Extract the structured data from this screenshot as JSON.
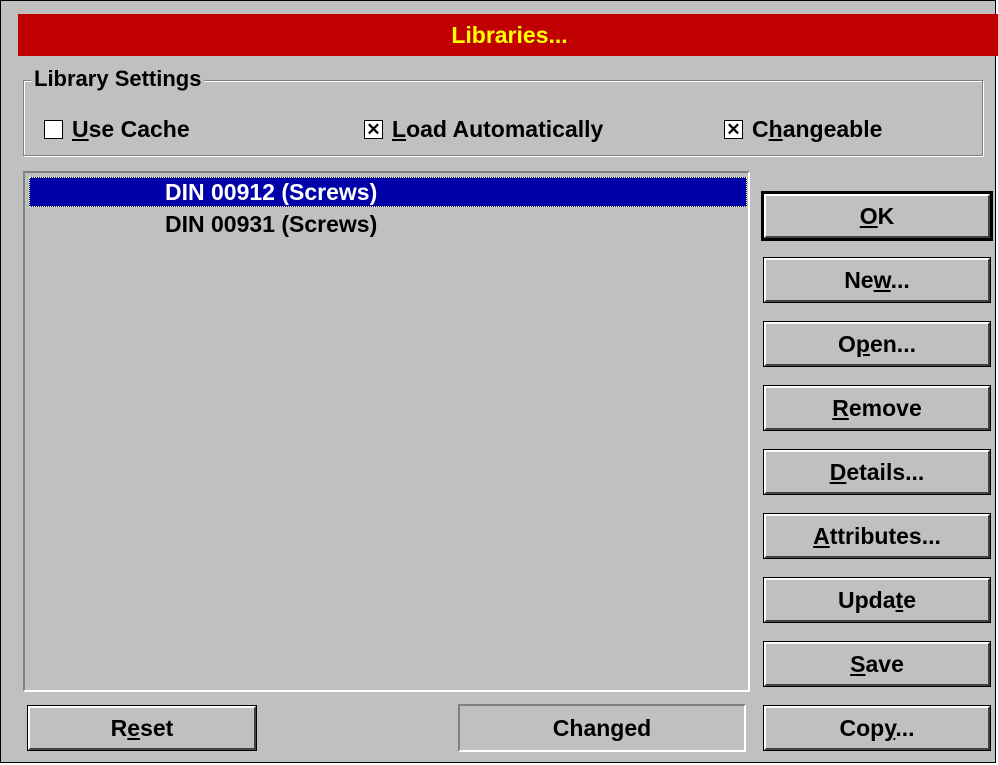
{
  "window": {
    "title": "Libraries..."
  },
  "settings": {
    "group_label": "Library Settings",
    "use_cache": {
      "label": "Use Cache",
      "mnemonic": "U",
      "checked": false
    },
    "load_automatically": {
      "label": "Load Automatically",
      "mnemonic": "L",
      "checked": true
    },
    "changeable": {
      "label": "Changeable",
      "mnemonic": "h",
      "checked": true
    }
  },
  "libraries": [
    {
      "name": "DIN 00912 (Screws)",
      "selected": true
    },
    {
      "name": "DIN 00931 (Screws)",
      "selected": false
    }
  ],
  "buttons": {
    "ok": "OK",
    "new": "New...",
    "open": "Open...",
    "remove": "Remove",
    "details": "Details...",
    "attributes": "Attributes...",
    "update": "Update",
    "save": "Save",
    "reset": "Reset",
    "copy": "Copy..."
  },
  "status": {
    "text": "Changed"
  }
}
